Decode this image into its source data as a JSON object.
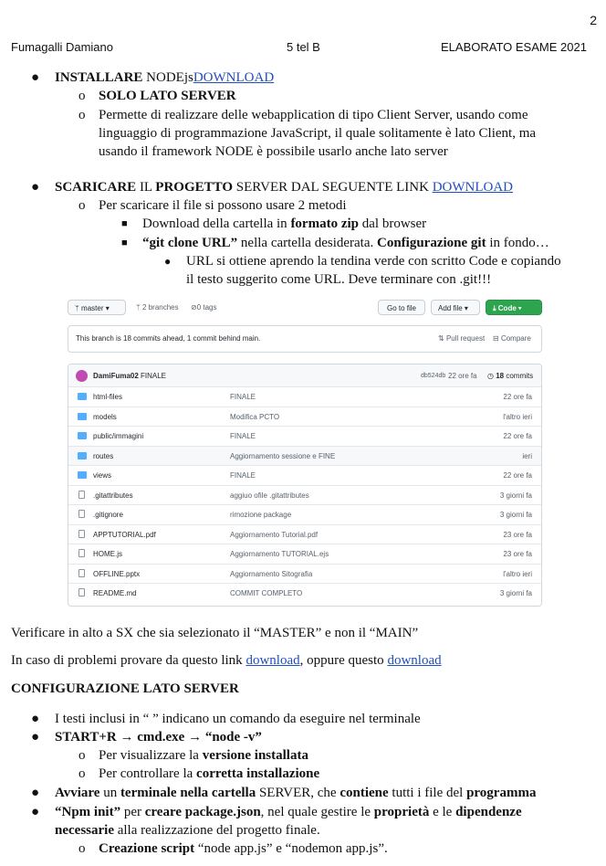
{
  "page_number": "2",
  "header": {
    "author": "Fumagalli Damiano",
    "class": "5 tel B",
    "title": "ELABORATO ESAME 2021"
  },
  "sec1": {
    "item_bold": "INSTALLARE",
    "item_text": "NODEjs",
    "item_link": "DOWNLOAD",
    "sub1": "SOLO LATO SERVER",
    "sub2_l1": "Permette di realizzare delle webapplication di tipo Client Server, usando come",
    "sub2_l2": "linguaggio di programmazione JavaScript, il quale solitamente è lato Client, ma",
    "sub2_l3": "usando il framework NODE è possibile usarlo anche lato server"
  },
  "sec2": {
    "b1": "SCARICARE",
    "t1": "IL",
    "b2": "PROGETTO",
    "t2": "SERVER DAL SEGUENTE LINK",
    "link": "DOWNLOAD",
    "sub": "Per scaricare il file si possono usare 2 metodi",
    "m1_a": "Download della cartella in",
    "m1_b": "formato zip",
    "m1_c": "dal browser",
    "m2_a": "“git clone URL”",
    "m2_b": "nella cartella desiderata.",
    "m2_c": "Configurazione git",
    "m2_d": "in fondo…",
    "url_l1": "URL si ottiene aprendo la tendina verde con scritto Code e copiando",
    "url_l2": "il testo suggerito come URL. Deve terminare con .git!!!"
  },
  "github": {
    "branch_btn": "master",
    "branches": "2 branches",
    "tags": "0 tags",
    "goto_btn": "Go to file",
    "addfile_btn": "Add file",
    "code_btn": "Code",
    "banner": "This branch is 18 commits ahead, 1 commit behind main.",
    "pull_request": "Pull request",
    "compare": "Compare",
    "commit_author": "DamiFuma02",
    "commit_msg": "FINALE",
    "commit_hash": "db524db",
    "commit_time": "22 ore fa",
    "commits_count": "18",
    "commits_label": "commits",
    "accent_green": "#2da44e",
    "files": [
      {
        "name": "html-files",
        "msg": "FINALE",
        "time": "22 ore fa",
        "icon": "folder-icon"
      },
      {
        "name": "models",
        "msg": "Modifica PCTO",
        "time": "l'altro ieri",
        "icon": "folder-icon"
      },
      {
        "name": "public/immagini",
        "msg": "FINALE",
        "time": "22 ore fa",
        "icon": "folder-icon"
      },
      {
        "name": "routes",
        "msg": "Aggiornamento sessione e FINE",
        "time": "ieri",
        "icon": "folder-icon"
      },
      {
        "name": "views",
        "msg": "FINALE",
        "time": "22 ore fa",
        "icon": "folder-icon"
      },
      {
        "name": ".gitattributes",
        "msg": "aggiuo ofile .gitattributes",
        "time": "3 giorni fa",
        "icon": "file-icon"
      },
      {
        "name": ".gitignore",
        "msg": "rimozione package",
        "time": "3 giorni fa",
        "icon": "file-icon"
      },
      {
        "name": "APPTUTORIAL.pdf",
        "msg": "Aggiornamento Tutorial.pdf",
        "time": "23 ore fa",
        "icon": "file-icon"
      },
      {
        "name": "HOME.js",
        "msg": "Aggiornamento TUTORIAL.ejs",
        "time": "23 ore fa",
        "icon": "file-icon"
      },
      {
        "name": "OFFLINE.pptx",
        "msg": "Aggiornamento Sitografia",
        "time": "l'altro ieri",
        "icon": "file-icon"
      },
      {
        "name": "README.md",
        "msg": "COMMIT COMPLETO",
        "time": "3 giorni fa",
        "icon": "file-icon"
      }
    ]
  },
  "verify": "Verificare in alto a SX che sia selezionato il “MASTER” e non il “MAIN”",
  "problems": {
    "text": "In caso di problemi provare da questo link",
    "link1": "download",
    "mid": ", oppure questo",
    "link2": "download"
  },
  "config_heading": "CONFIGURAZIONE LATO SERVER",
  "config": {
    "i1": "I testi inclusi in “  ” indicano un comando da eseguire nel terminale",
    "i2": "START+R → cmd.exe → “node -v”",
    "i2_s1_a": "Per visualizzare la",
    "i2_s1_b": "versione installata",
    "i2_s2_a": "Per controllare la",
    "i2_s2_b": "corretta installazione",
    "i3_a": "Avviare",
    "i3_b": "un",
    "i3_c": "terminale nella cartella",
    "i3_d": "SERVER, che",
    "i3_e": "contiene",
    "i3_f": "tutti i file del",
    "i3_g": "programma",
    "i4_a": "“Npm init”",
    "i4_b": "per",
    "i4_c": "creare package.json",
    "i4_d": ", nel quale gestire le",
    "i4_e": "proprietà",
    "i4_f": "e le",
    "i4_g": "dipendenze",
    "i4_l2_a": "necessarie",
    "i4_l2_b": "alla realizzazione del progetto finale.",
    "i4_s1_a": "Creazione script",
    "i4_s1_b": "“node app.js” e “nodemon app.js”."
  }
}
